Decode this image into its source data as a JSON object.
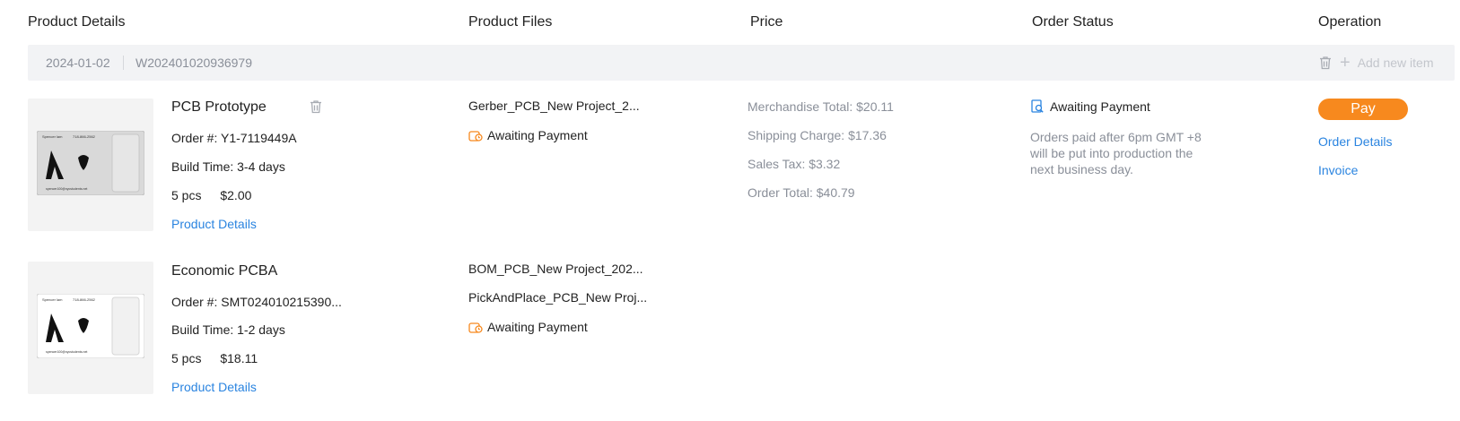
{
  "header": {
    "product_details": "Product Details",
    "product_files": "Product Files",
    "price": "Price",
    "order_status": "Order Status",
    "operation": "Operation"
  },
  "group": {
    "date": "2024-01-02",
    "order_id": "W202401020936979",
    "add_new_item": "Add new item",
    "trash_icon": "trash-icon",
    "plus_icon": "plus-icon"
  },
  "items": [
    {
      "name": "PCB Prototype",
      "order_label": "Order #:",
      "order_no": "Y1-7119449A",
      "build_time": "Build Time: 3-4 days",
      "qty": "5 pcs",
      "price": "$2.00",
      "details_link": "Product Details",
      "files": [
        "Gerber_PCB_New Project_2..."
      ],
      "file_status": "Awaiting Payment"
    },
    {
      "name": "Economic PCBA",
      "order_label": "Order #:",
      "order_no": "SMT024010215390...",
      "build_time": "Build Time: 1-2 days",
      "qty": "5 pcs",
      "price": "$18.11",
      "details_link": "Product Details",
      "files": [
        "BOM_PCB_New Project_202...",
        "PickAndPlace_PCB_New Proj..."
      ],
      "file_status": "Awaiting Payment"
    }
  ],
  "price_summary": {
    "merchandise_total": "Merchandise Total: $20.11",
    "shipping_charge": "Shipping Charge: $17.36",
    "sales_tax": "Sales Tax: $3.32",
    "order_total": "Order Total: $40.79"
  },
  "order_status": {
    "title": "Awaiting Payment",
    "note": "Orders paid after 6pm GMT +8 will be put into production the next business day."
  },
  "operation": {
    "pay": "Pay",
    "order_details": "Order Details",
    "invoice": "Invoice"
  },
  "colors": {
    "accent_link": "#2a84e0",
    "pay_button": "#f7891e",
    "muted_text": "#8a8f99",
    "group_bar_bg": "#f2f3f5"
  }
}
